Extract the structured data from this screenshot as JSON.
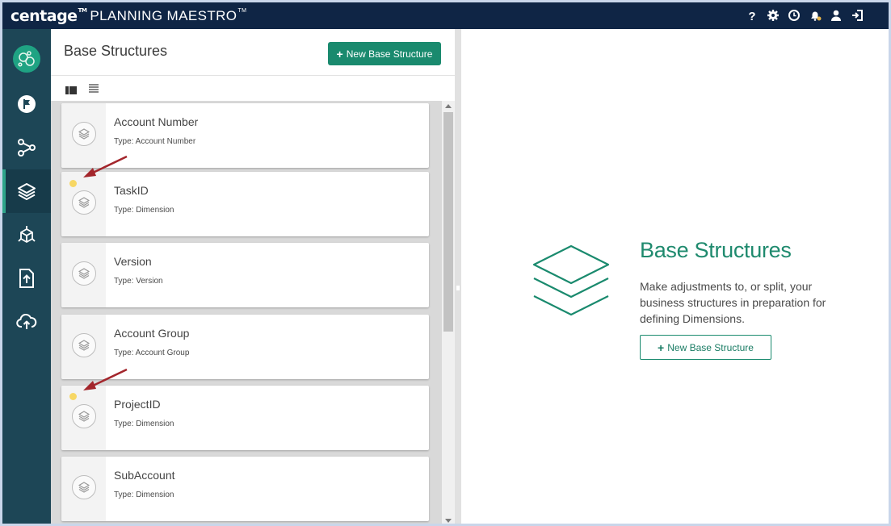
{
  "header": {
    "brand": "centage",
    "brand_tm": "TM",
    "product": "PLANNING MAESTRO",
    "product_tm": "TM",
    "icons": [
      "help-icon",
      "settings-icon",
      "clock-icon",
      "notification-bell-icon",
      "user-icon",
      "logout-icon"
    ]
  },
  "nav": {
    "items": [
      {
        "icon": "flag-icon"
      },
      {
        "icon": "connections-icon"
      },
      {
        "icon": "layers-icon",
        "active": true
      },
      {
        "icon": "model-cube-icon"
      },
      {
        "icon": "file-upload-icon"
      },
      {
        "icon": "cloud-upload-icon"
      }
    ]
  },
  "list_panel": {
    "title": "Base Structures",
    "new_button": {
      "plus": "+",
      "label": "New Base Structure"
    },
    "cards": [
      {
        "name": "Account Number",
        "type": "Type: Account Number",
        "indicator": false
      },
      {
        "name": "TaskID",
        "type": "Type: Dimension",
        "indicator": true
      },
      {
        "name": "Version",
        "type": "Type: Version",
        "indicator": false
      },
      {
        "name": "Account Group",
        "type": "Type: Account Group",
        "indicator": false
      },
      {
        "name": "ProjectID",
        "type": "Type: Dimension",
        "indicator": true
      },
      {
        "name": "SubAccount",
        "type": "Type: Dimension",
        "indicator": false
      }
    ]
  },
  "detail": {
    "title": "Base Structures",
    "description": "Make adjustments to, or split, your business structures in preparation for defining Dimensions.",
    "button": {
      "plus": "+",
      "label": "New Base Structure"
    }
  },
  "colors": {
    "topbar": "#0f2545",
    "nav": "#1d4656",
    "accent": "#1a8a6e",
    "indicator_dot": "#f7d764",
    "annotation_arrow": "#a3262c"
  }
}
